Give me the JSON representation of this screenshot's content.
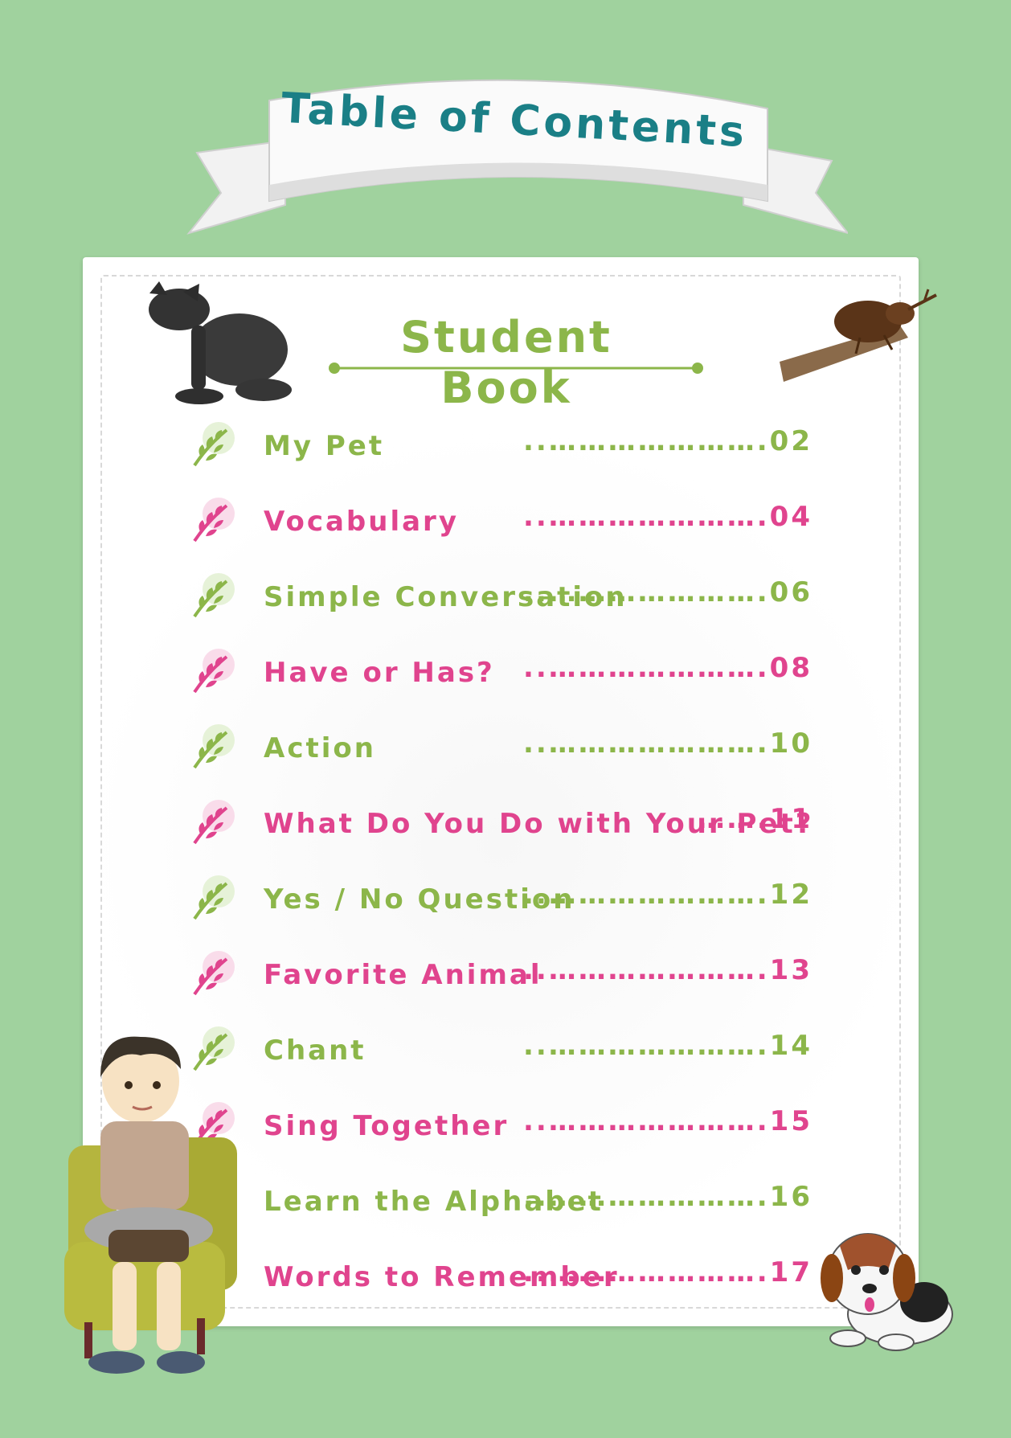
{
  "header": {
    "title": "Table of Contents"
  },
  "section": {
    "title": "Student Book"
  },
  "colors": {
    "background": "#a0d29e",
    "title_teal": "#1a7f86",
    "green": "#8cb64a",
    "pink": "#e0448e"
  },
  "toc": [
    {
      "label": "My Pet",
      "page": "..………………….02",
      "color": "green"
    },
    {
      "label": "Vocabulary",
      "page": "..………………….04",
      "color": "pink"
    },
    {
      "label": "Simple Conversation",
      "page": "..………………….06",
      "color": "green"
    },
    {
      "label": "Have or Has?",
      "page": "..………………….08",
      "color": "pink"
    },
    {
      "label": "Action",
      "page": "..………………….10",
      "color": "green"
    },
    {
      "label": "What Do You Do with Your Pet?",
      "page": "…….11",
      "color": "pink"
    },
    {
      "label": "Yes / No Question",
      "page": "..………………….12",
      "color": "green"
    },
    {
      "label": "Favorite Animal",
      "page": "..………………….13",
      "color": "pink"
    },
    {
      "label": "Chant",
      "page": "..………………….14",
      "color": "green"
    },
    {
      "label": "Sing Together",
      "page": "..………………….15",
      "color": "pink"
    },
    {
      "label": "Learn the Alphabet",
      "page": "..………………….16",
      "color": "green"
    },
    {
      "label": "Words to Remember",
      "page": "..………………….17",
      "color": "pink"
    }
  ],
  "icons": [
    "leaf-icon"
  ]
}
